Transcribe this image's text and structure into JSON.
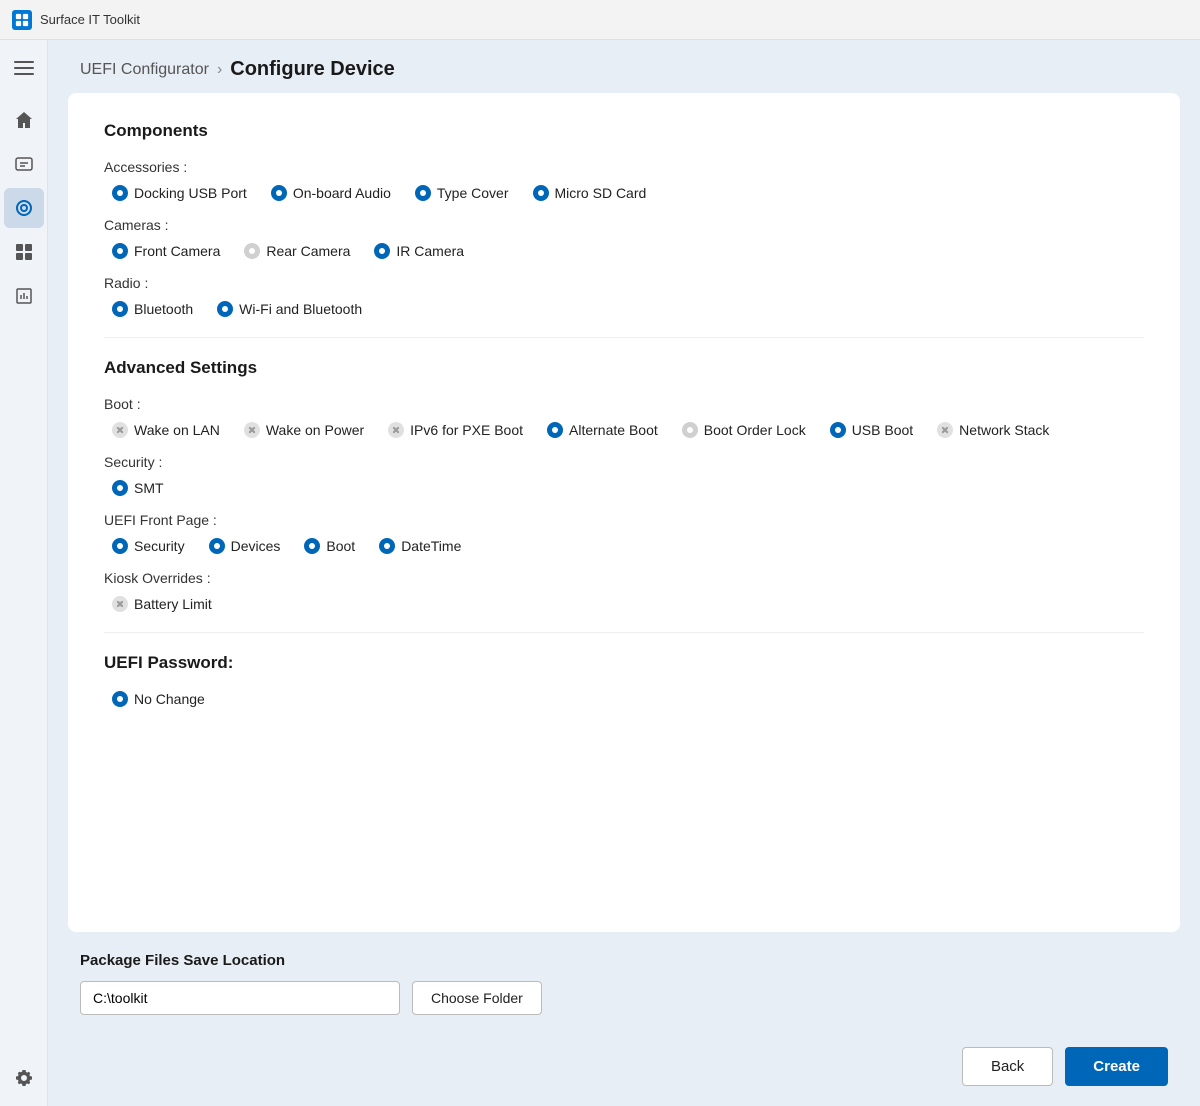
{
  "titleBar": {
    "appName": "Surface IT Toolkit"
  },
  "breadcrumb": {
    "parent": "UEFI Configurator",
    "separator": "›",
    "current": "Configure Device"
  },
  "components": {
    "sectionTitle": "Components",
    "accessories": {
      "label": "Accessories :",
      "items": [
        {
          "id": "docking-usb",
          "label": "Docking USB Port",
          "state": "blue"
        },
        {
          "id": "onboard-audio",
          "label": "On-board Audio",
          "state": "blue"
        },
        {
          "id": "type-cover",
          "label": "Type Cover",
          "state": "blue"
        },
        {
          "id": "micro-sd",
          "label": "Micro SD Card",
          "state": "blue"
        }
      ]
    },
    "cameras": {
      "label": "Cameras :",
      "items": [
        {
          "id": "front-camera",
          "label": "Front Camera",
          "state": "blue"
        },
        {
          "id": "rear-camera",
          "label": "Rear Camera",
          "state": "gray"
        },
        {
          "id": "ir-camera",
          "label": "IR Camera",
          "state": "blue"
        }
      ]
    },
    "radio": {
      "label": "Radio :",
      "items": [
        {
          "id": "bluetooth",
          "label": "Bluetooth",
          "state": "blue"
        },
        {
          "id": "wifi-bluetooth",
          "label": "Wi-Fi and Bluetooth",
          "state": "blue"
        }
      ]
    }
  },
  "advancedSettings": {
    "sectionTitle": "Advanced Settings",
    "boot": {
      "label": "Boot :",
      "items": [
        {
          "id": "wake-on-lan",
          "label": "Wake on LAN",
          "state": "x"
        },
        {
          "id": "wake-on-power",
          "label": "Wake on Power",
          "state": "x"
        },
        {
          "id": "ipv6-pxe",
          "label": "IPv6 for PXE Boot",
          "state": "x"
        },
        {
          "id": "alternate-boot",
          "label": "Alternate Boot",
          "state": "blue"
        },
        {
          "id": "boot-order-lock",
          "label": "Boot Order Lock",
          "state": "gray"
        },
        {
          "id": "usb-boot",
          "label": "USB Boot",
          "state": "blue"
        },
        {
          "id": "network-stack",
          "label": "Network Stack",
          "state": "x"
        }
      ]
    },
    "security": {
      "label": "Security :",
      "items": [
        {
          "id": "smt",
          "label": "SMT",
          "state": "blue"
        }
      ]
    },
    "uefiFrontPage": {
      "label": "UEFI Front Page :",
      "items": [
        {
          "id": "security",
          "label": "Security",
          "state": "blue"
        },
        {
          "id": "devices",
          "label": "Devices",
          "state": "blue"
        },
        {
          "id": "boot",
          "label": "Boot",
          "state": "blue"
        },
        {
          "id": "datetime",
          "label": "DateTime",
          "state": "blue"
        }
      ]
    },
    "kioskOverrides": {
      "label": "Kiosk Overrides :",
      "items": [
        {
          "id": "battery-limit",
          "label": "Battery Limit",
          "state": "x"
        }
      ]
    }
  },
  "uefiPassword": {
    "sectionTitle": "UEFI Password:",
    "items": [
      {
        "id": "no-change",
        "label": "No Change",
        "state": "blue"
      }
    ]
  },
  "packageSave": {
    "label": "Package Files Save Location",
    "inputValue": "C:\\toolkit",
    "chooseFolderLabel": "Choose Folder"
  },
  "actions": {
    "backLabel": "Back",
    "createLabel": "Create"
  },
  "sidebar": {
    "items": [
      {
        "id": "home",
        "icon": "home"
      },
      {
        "id": "profile",
        "icon": "profile"
      },
      {
        "id": "uefi",
        "icon": "uefi",
        "active": true
      },
      {
        "id": "apps",
        "icon": "apps"
      },
      {
        "id": "reports",
        "icon": "reports"
      }
    ],
    "bottomItems": [
      {
        "id": "settings",
        "icon": "settings"
      }
    ]
  }
}
